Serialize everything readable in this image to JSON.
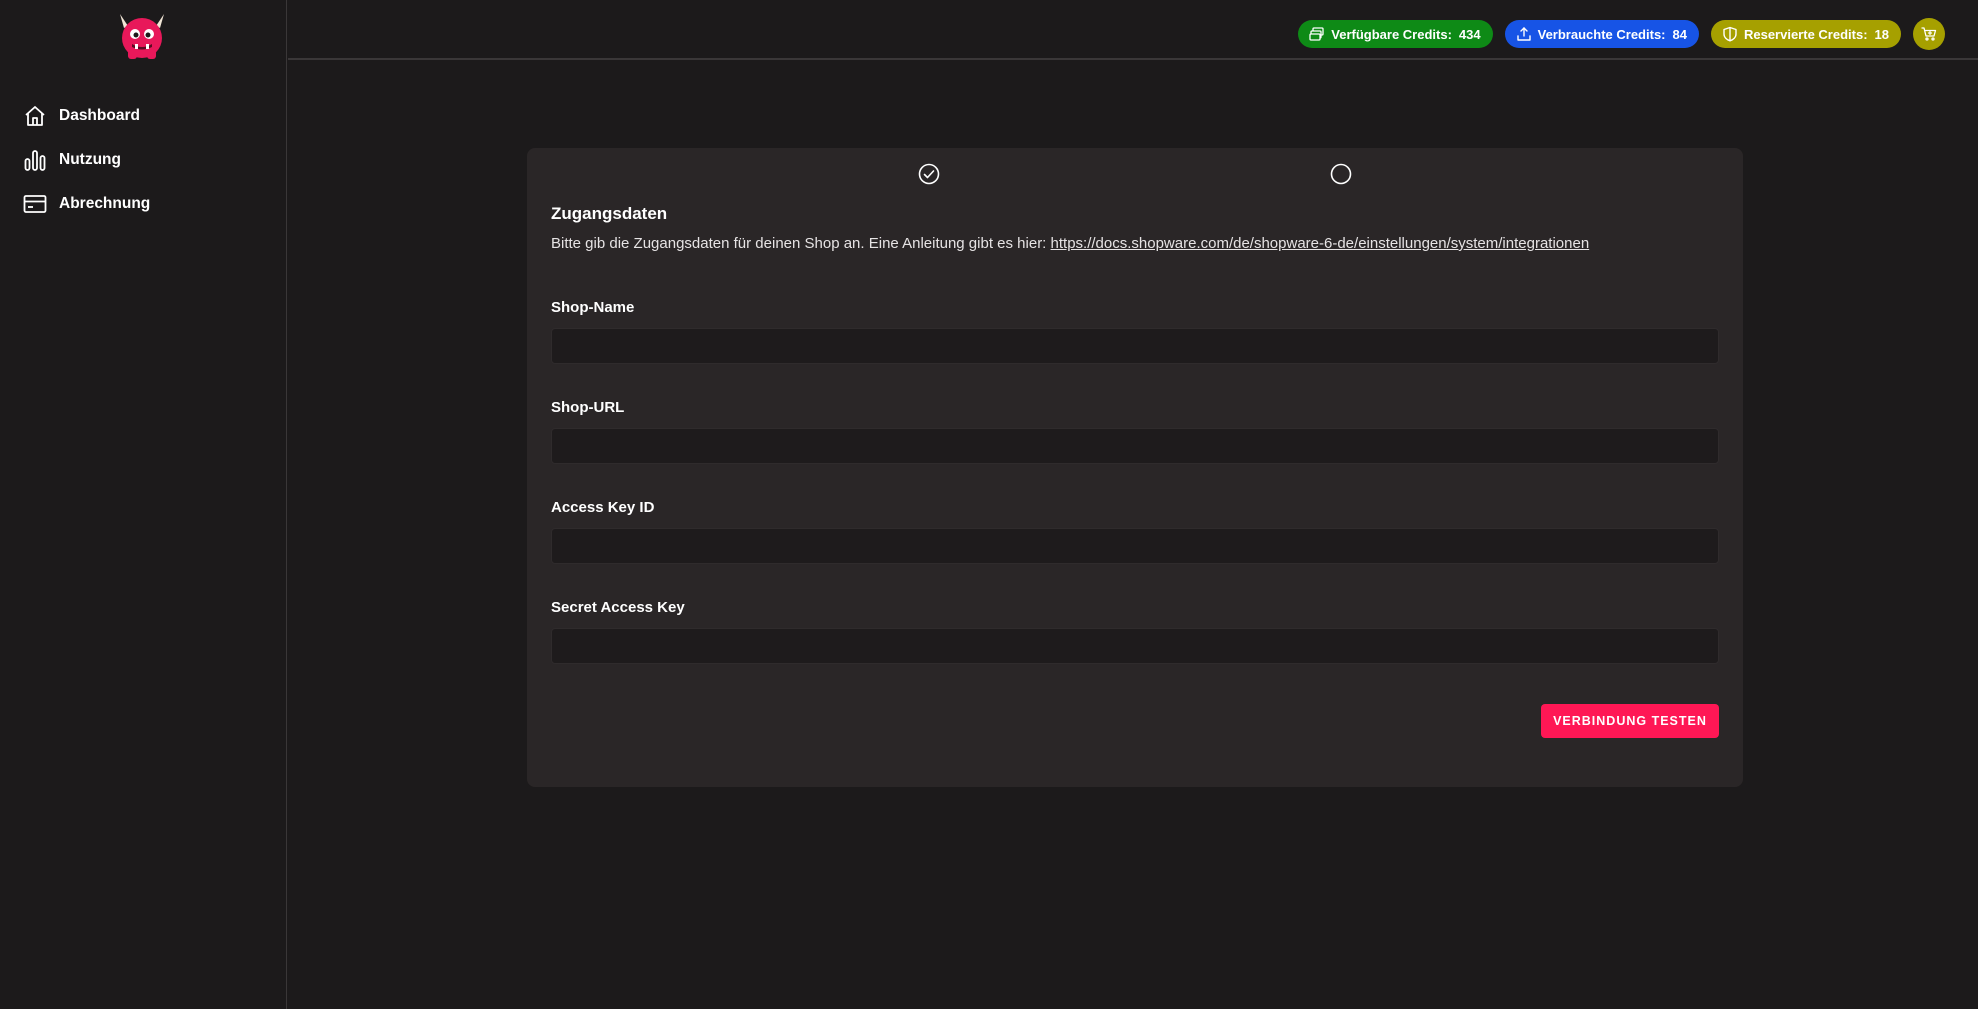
{
  "sidebar": {
    "logo_icon": "monster-logo-icon",
    "items": [
      {
        "label": "Dashboard",
        "icon": "home-icon"
      },
      {
        "label": "Nutzung",
        "icon": "bar-chart-icon"
      },
      {
        "label": "Abrechnung",
        "icon": "credit-card-icon"
      }
    ]
  },
  "header": {
    "credits": [
      {
        "label": "Verfügbare Credits:",
        "value": "434",
        "color": "#0e8a16",
        "icon": "coins-icon"
      },
      {
        "label": "Verbrauchte Credits:",
        "value": "84",
        "color": "#1754e6",
        "icon": "upload-icon"
      },
      {
        "label": "Reservierte Credits:",
        "value": "18",
        "color": "#a6a000",
        "icon": "shield-icon"
      }
    ],
    "cart_icon": "cart-icon"
  },
  "wizard": {
    "steps": [
      {
        "state": "completed",
        "icon": "check-circle-icon"
      },
      {
        "state": "pending",
        "icon": "circle-icon"
      }
    ],
    "title": "Zugangsdaten",
    "intro_text": "Bitte gib die Zugangsdaten für deinen Shop an. Eine Anleitung gibt es hier: ",
    "intro_link": "https://docs.shopware.com/de/shopware-6-de/einstellungen/system/integrationen",
    "fields": [
      {
        "label": "Shop-Name",
        "value": ""
      },
      {
        "label": "Shop-URL",
        "value": ""
      },
      {
        "label": "Access Key ID",
        "value": ""
      },
      {
        "label": "Secret Access Key",
        "value": ""
      }
    ],
    "test_button": "VERBINDUNG TESTEN"
  },
  "colors": {
    "accent": "#ff1755",
    "background": "#1c1a1b",
    "card": "#2a2627"
  }
}
